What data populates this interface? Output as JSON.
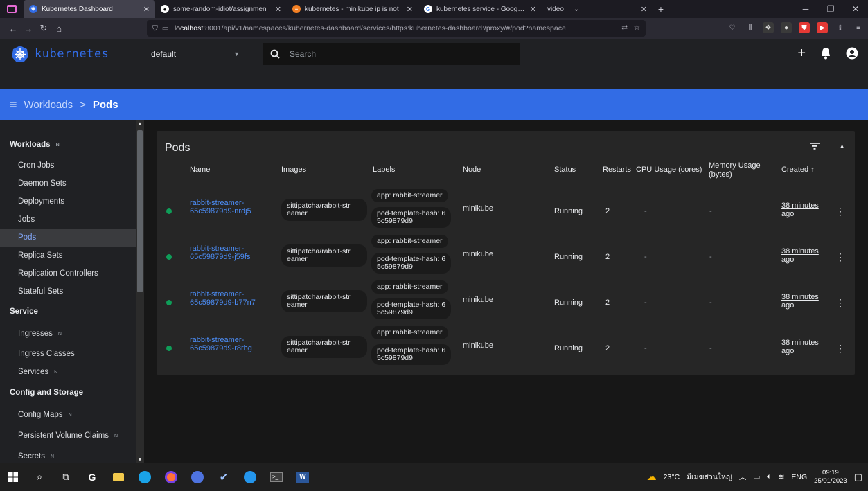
{
  "browser": {
    "tabs": [
      {
        "title": "Kubernetes Dashboard",
        "active": true
      },
      {
        "title": "some-random-idiot/assignmen",
        "active": false
      },
      {
        "title": "kubernetes - minikube ip is not",
        "active": false
      },
      {
        "title": "kubernetes service - Google Se",
        "active": false
      },
      {
        "title": "video",
        "active": false
      }
    ],
    "url_host": "localhost",
    "url_rest": ":8001/api/v1/namespaces/kubernetes-dashboard/services/https:kubernetes-dashboard:/proxy/#/pod?namespace"
  },
  "header": {
    "brand": "kubernetes",
    "namespace": "default",
    "search_placeholder": "Search"
  },
  "breadcrumb": {
    "parent": "Workloads",
    "separator": ">",
    "current": "Pods"
  },
  "sidebar": [
    {
      "label": "Workloads",
      "type": "header",
      "badge": "N"
    },
    {
      "label": "Cron Jobs",
      "type": "item"
    },
    {
      "label": "Daemon Sets",
      "type": "item"
    },
    {
      "label": "Deployments",
      "type": "item"
    },
    {
      "label": "Jobs",
      "type": "item"
    },
    {
      "label": "Pods",
      "type": "item",
      "active": true
    },
    {
      "label": "Replica Sets",
      "type": "item"
    },
    {
      "label": "Replication Controllers",
      "type": "item"
    },
    {
      "label": "Stateful Sets",
      "type": "item"
    },
    {
      "label": "Service",
      "type": "header"
    },
    {
      "label": "Ingresses",
      "type": "item",
      "badge": "N"
    },
    {
      "label": "Ingress Classes",
      "type": "item"
    },
    {
      "label": "Services",
      "type": "item",
      "badge": "N"
    },
    {
      "label": "Config and Storage",
      "type": "header"
    },
    {
      "label": "Config Maps",
      "type": "item",
      "badge": "N"
    },
    {
      "label": "Persistent Volume Claims",
      "type": "item",
      "badge": "N"
    },
    {
      "label": "Secrets",
      "type": "item",
      "badge": "N"
    }
  ],
  "pods_card": {
    "title": "Pods",
    "columns": [
      "Name",
      "Images",
      "Labels",
      "Node",
      "Status",
      "Restarts",
      "CPU Usage (cores)",
      "Memory Usage (bytes)",
      "Created"
    ],
    "created_sort_arrow": "↑",
    "rows": [
      {
        "name_1": "rabbit-streamer-",
        "name_2": "65c59879d9-nrdj5",
        "image_1": "sittipatcha/rabbit-str",
        "image_2": "eamer",
        "label_app": "app: rabbit-streamer",
        "label_hash_1": "pod-template-hash: 6",
        "label_hash_2": "5c59879d9",
        "node": "minikube",
        "status": "Running",
        "restarts": "2",
        "cpu": "-",
        "memory": "-",
        "created_1": "38 minutes",
        "created_2": "ago"
      },
      {
        "name_1": "rabbit-streamer-",
        "name_2": "65c59879d9-j59fs",
        "image_1": "sittipatcha/rabbit-str",
        "image_2": "eamer",
        "label_app": "app: rabbit-streamer",
        "label_hash_1": "pod-template-hash: 6",
        "label_hash_2": "5c59879d9",
        "node": "minikube",
        "status": "Running",
        "restarts": "2",
        "cpu": "-",
        "memory": "-",
        "created_1": "38 minutes",
        "created_2": "ago"
      },
      {
        "name_1": "rabbit-streamer-",
        "name_2": "65c59879d9-b77n7",
        "image_1": "sittipatcha/rabbit-str",
        "image_2": "eamer",
        "label_app": "app: rabbit-streamer",
        "label_hash_1": "pod-template-hash: 6",
        "label_hash_2": "5c59879d9",
        "node": "minikube",
        "status": "Running",
        "restarts": "2",
        "cpu": "-",
        "memory": "-",
        "created_1": "38 minutes",
        "created_2": "ago"
      },
      {
        "name_1": "rabbit-streamer-",
        "name_2": "65c59879d9-r8rbg",
        "image_1": "sittipatcha/rabbit-str",
        "image_2": "eamer",
        "label_app": "app: rabbit-streamer",
        "label_hash_1": "pod-template-hash: 6",
        "label_hash_2": "5c59879d9",
        "node": "minikube",
        "status": "Running",
        "restarts": "2",
        "cpu": "-",
        "memory": "-",
        "created_1": "38 minutes",
        "created_2": "ago"
      }
    ]
  },
  "taskbar": {
    "weather": "23°C",
    "weather_text": "มีเมฆส่วนใหญ่",
    "lang": "ENG",
    "time": "09:19",
    "date": "25/01/2023"
  },
  "colors": {
    "accent": "#326ce5",
    "running": "#0f9d58",
    "link": "#4c8df6"
  }
}
